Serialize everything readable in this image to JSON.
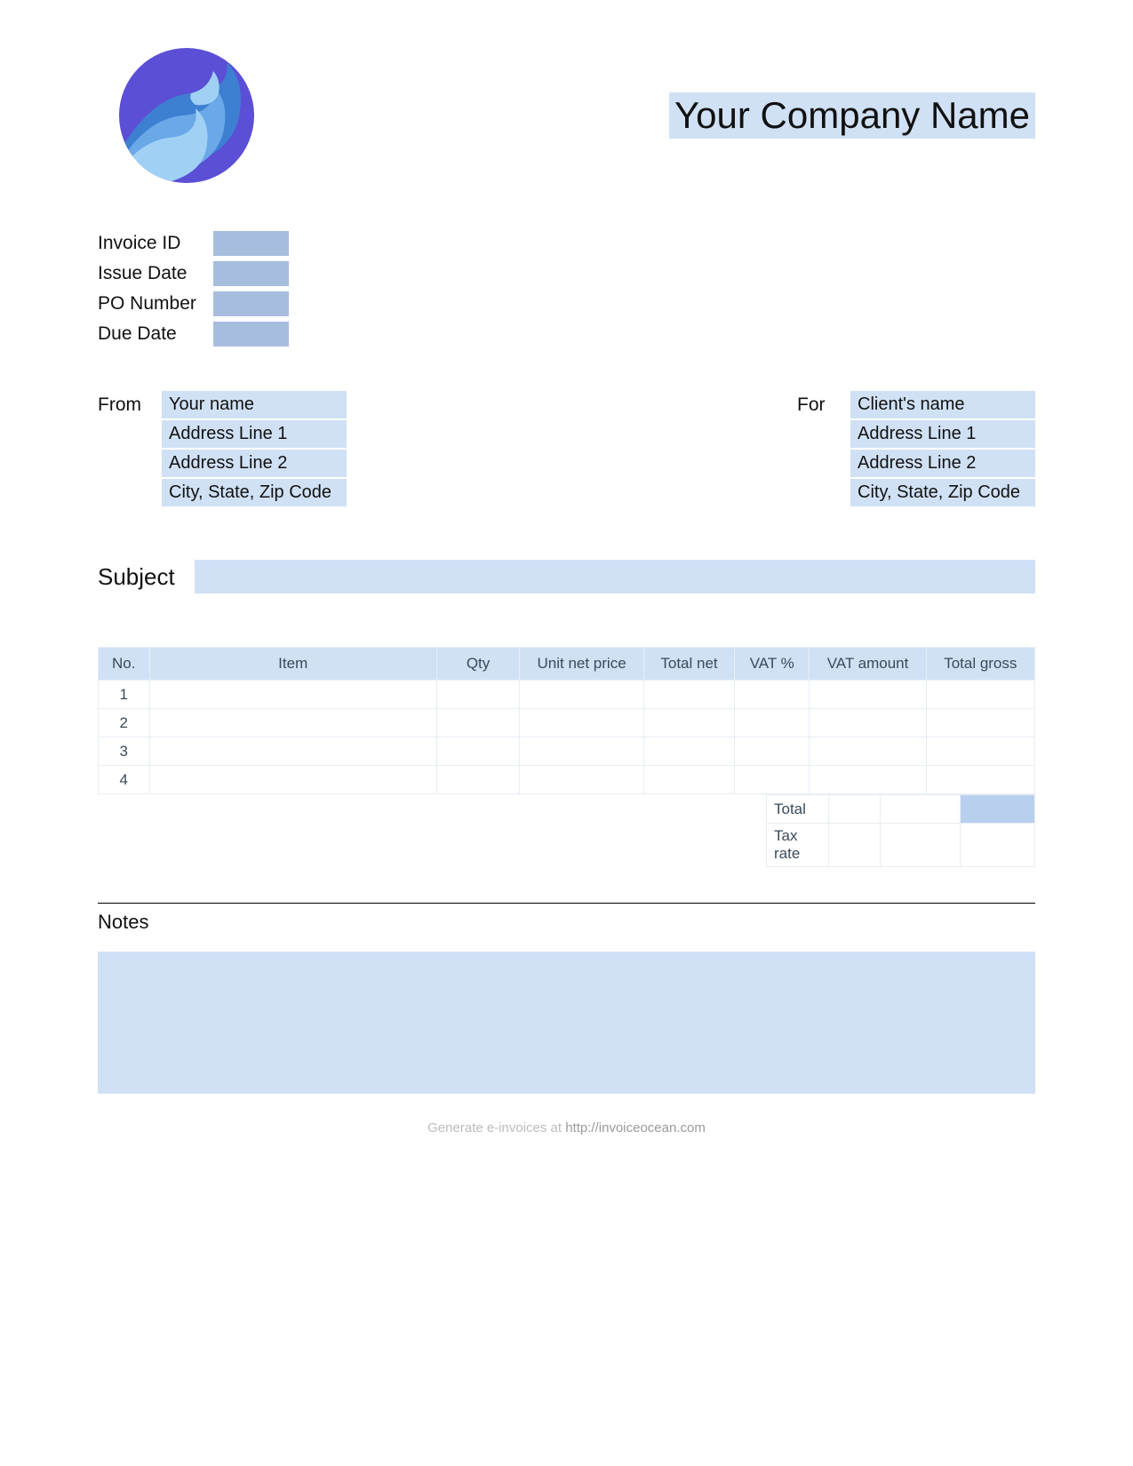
{
  "header": {
    "company_name": "Your Company Name"
  },
  "meta": {
    "labels": {
      "invoice_id": "Invoice ID",
      "issue_date": "Issue Date",
      "po_number": "PO Number",
      "due_date": "Due Date"
    },
    "values": {
      "invoice_id": "",
      "issue_date": "",
      "po_number": "",
      "due_date": ""
    }
  },
  "from": {
    "label": "From",
    "lines": [
      "Your name",
      "Address Line 1",
      "Address Line 2",
      "City, State, Zip Code"
    ]
  },
  "for": {
    "label": "For",
    "lines": [
      "Client's name",
      "Address Line 1",
      "Address Line 2",
      "City, State, Zip Code"
    ]
  },
  "subject": {
    "label": "Subject",
    "value": ""
  },
  "table": {
    "headers": {
      "no": "No.",
      "item": "Item",
      "qty": "Qty",
      "unit_net_price": "Unit net price",
      "total_net": "Total net",
      "vat_pct": "VAT %",
      "vat_amount": "VAT amount",
      "total_gross": "Total gross"
    },
    "rows": [
      {
        "no": "1",
        "item": "",
        "qty": "",
        "unit_net_price": "",
        "total_net": "",
        "vat_pct": "",
        "vat_amount": "",
        "total_gross": ""
      },
      {
        "no": "2",
        "item": "",
        "qty": "",
        "unit_net_price": "",
        "total_net": "",
        "vat_pct": "",
        "vat_amount": "",
        "total_gross": ""
      },
      {
        "no": "3",
        "item": "",
        "qty": "",
        "unit_net_price": "",
        "total_net": "",
        "vat_pct": "",
        "vat_amount": "",
        "total_gross": ""
      },
      {
        "no": "4",
        "item": "",
        "qty": "",
        "unit_net_price": "",
        "total_net": "",
        "vat_pct": "",
        "vat_amount": "",
        "total_gross": ""
      }
    ],
    "summary": {
      "total_label": "Total",
      "tax_rate_label": "Tax rate",
      "total": {
        "vat_pct": "",
        "vat_amount": "",
        "total_gross": ""
      },
      "tax_rate": {
        "vat_pct": "",
        "vat_amount": "",
        "total_gross": ""
      }
    }
  },
  "notes": {
    "label": "Notes",
    "value": ""
  },
  "footer": {
    "prefix": "Generate e-invoices at ",
    "link": "http://invoiceocean.com"
  }
}
